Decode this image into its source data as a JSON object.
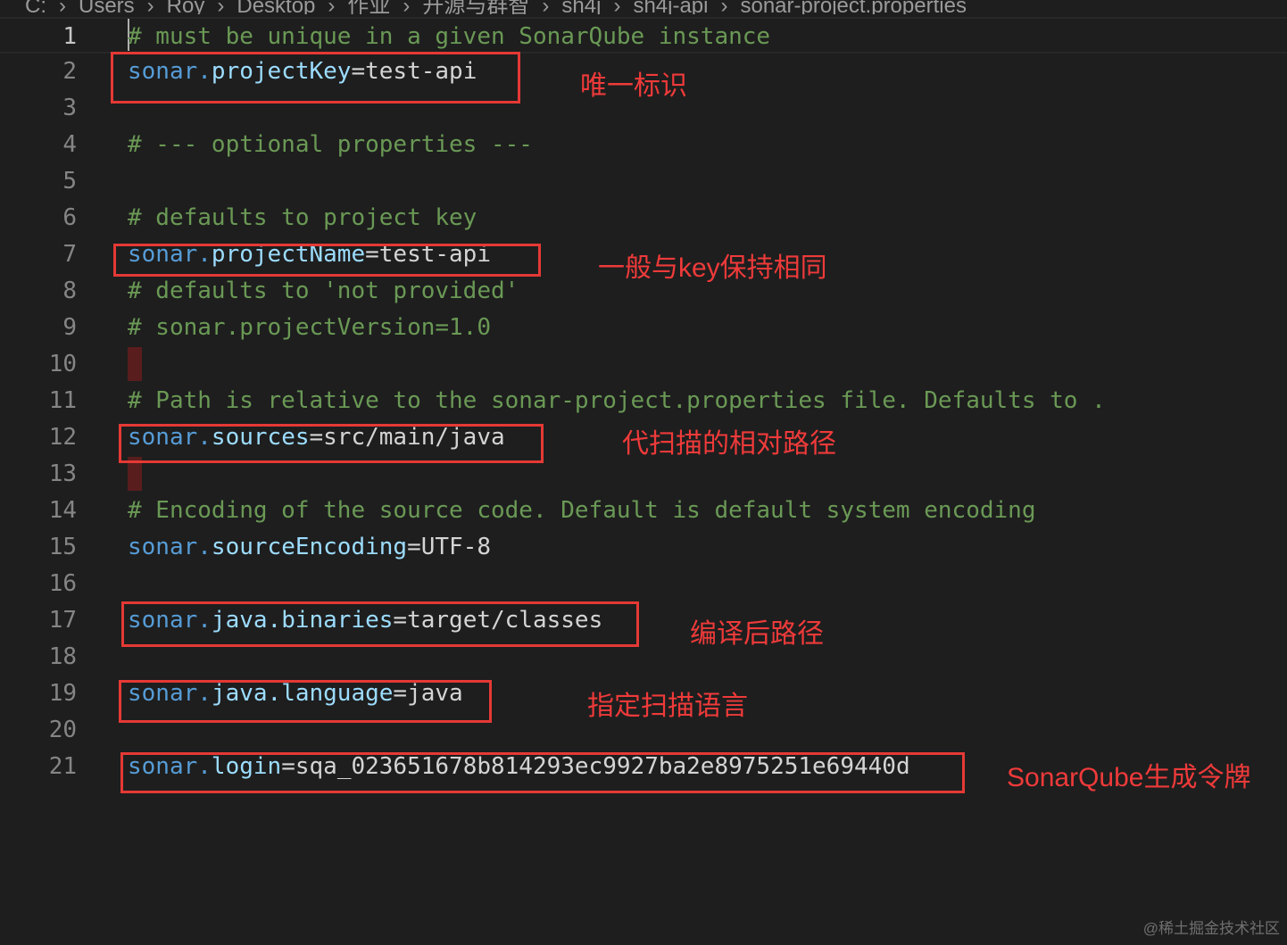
{
  "breadcrumb": [
    "C:",
    "Users",
    "Roy",
    "Desktop",
    "作业",
    "开源与群智",
    "sh4j",
    "sh4j-api",
    "sonar-project.properties"
  ],
  "lines": [
    {
      "n": "1",
      "parts": [
        {
          "t": "# must be unique in a given SonarQube instance",
          "c": "c"
        }
      ]
    },
    {
      "n": "2",
      "parts": [
        {
          "t": "sonar.",
          "c": "k"
        },
        {
          "t": "projectKey",
          "c": "p"
        },
        {
          "t": "=test-api",
          "c": "v"
        }
      ]
    },
    {
      "n": "3",
      "parts": []
    },
    {
      "n": "4",
      "parts": [
        {
          "t": "# --- optional properties ---",
          "c": "c"
        }
      ]
    },
    {
      "n": "5",
      "parts": []
    },
    {
      "n": "6",
      "parts": [
        {
          "t": "# defaults to project key",
          "c": "c"
        }
      ]
    },
    {
      "n": "7",
      "parts": [
        {
          "t": "sonar.",
          "c": "k"
        },
        {
          "t": "projectName",
          "c": "p"
        },
        {
          "t": "=test-api",
          "c": "v"
        }
      ]
    },
    {
      "n": "8",
      "parts": [
        {
          "t": "# defaults to 'not provided'",
          "c": "c"
        }
      ]
    },
    {
      "n": "9",
      "parts": [
        {
          "t": "# sonar.projectVersion=1.0",
          "c": "c"
        }
      ]
    },
    {
      "n": "10",
      "parts": []
    },
    {
      "n": "11",
      "parts": [
        {
          "t": "# Path is relative to the sonar-project.properties file. Defaults to .",
          "c": "c"
        }
      ]
    },
    {
      "n": "12",
      "parts": [
        {
          "t": "sonar.",
          "c": "k"
        },
        {
          "t": "sources",
          "c": "p"
        },
        {
          "t": "=src/main/java",
          "c": "v"
        }
      ]
    },
    {
      "n": "13",
      "parts": []
    },
    {
      "n": "14",
      "parts": [
        {
          "t": "# Encoding of the source code. Default is default system encoding",
          "c": "c"
        }
      ]
    },
    {
      "n": "15",
      "parts": [
        {
          "t": "sonar.",
          "c": "k"
        },
        {
          "t": "sourceEncoding",
          "c": "p"
        },
        {
          "t": "=UTF-8",
          "c": "v"
        }
      ]
    },
    {
      "n": "16",
      "parts": []
    },
    {
      "n": "17",
      "parts": [
        {
          "t": "sonar.",
          "c": "k"
        },
        {
          "t": "java.binaries",
          "c": "p"
        },
        {
          "t": "=target/classes",
          "c": "v"
        }
      ]
    },
    {
      "n": "18",
      "parts": []
    },
    {
      "n": "19",
      "parts": [
        {
          "t": "sonar.",
          "c": "k"
        },
        {
          "t": "java.language",
          "c": "p"
        },
        {
          "t": "=java",
          "c": "v"
        }
      ]
    },
    {
      "n": "20",
      "parts": []
    },
    {
      "n": "21",
      "parts": [
        {
          "t": "sonar.",
          "c": "k"
        },
        {
          "t": "login",
          "c": "p"
        },
        {
          "t": "=sqa_023651678b814293ec9927ba2e8975251e69440d",
          "c": "v"
        }
      ]
    }
  ],
  "annotations": {
    "project_key": "唯一标识",
    "project_name": "一般与key保持相同",
    "sources": "代扫描的相对路径",
    "binaries": "编译后路径",
    "language": "指定扫描语言",
    "login": "SonarQube生成令牌"
  },
  "watermark": "@稀土掘金技术社区",
  "colors": {
    "annotation": "#e53935",
    "comment": "#6a9955",
    "keyword": "#569cd6",
    "property": "#9cdcfe"
  }
}
